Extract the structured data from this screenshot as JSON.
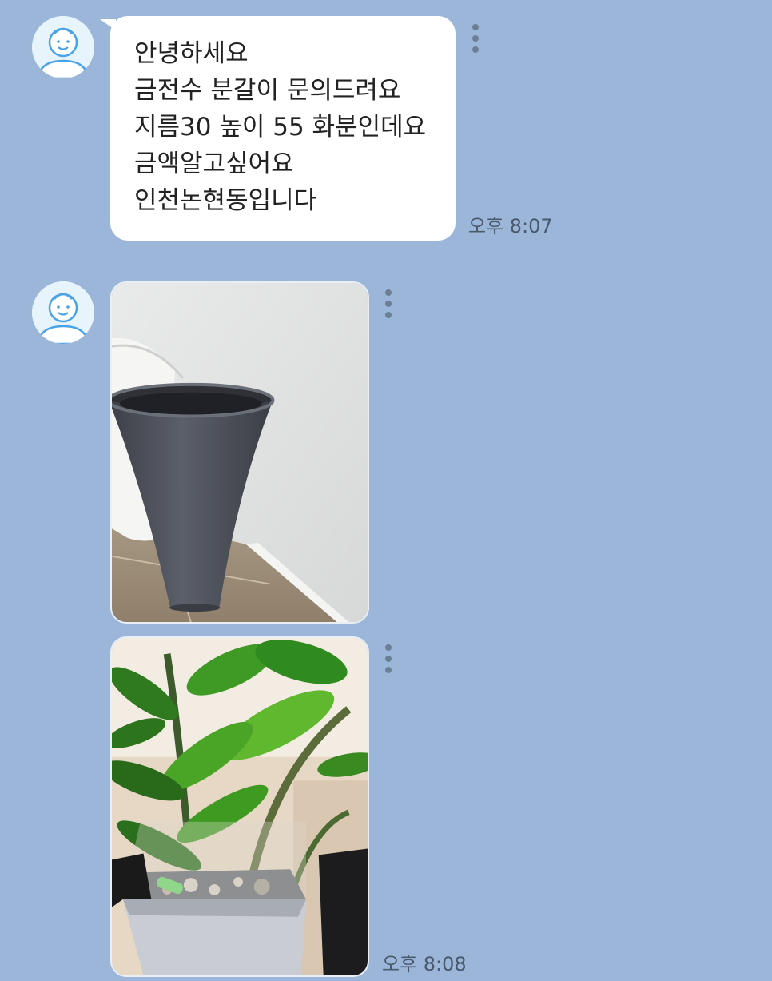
{
  "conversation": {
    "messages": [
      {
        "type": "text",
        "lines": [
          "안녕하세요",
          "금전수 분갈이 문의드려요",
          "지름30 높이 55 화분인데요",
          "금액알고싶어요",
          "인천논현동입니다"
        ],
        "time": "오후 8:07"
      },
      {
        "type": "image",
        "subject": "gray-tall-planter-photo"
      },
      {
        "type": "image",
        "subject": "zz-plant-square-pot-photo",
        "time": "오후 8:08"
      }
    ]
  },
  "icons": {
    "avatar": "default-profile-icon",
    "more": "vertical-dots-icon"
  },
  "colors": {
    "background": "#9bb6d8",
    "bubble": "#ffffff",
    "text": "#222222",
    "time": "#4a5a6e"
  }
}
